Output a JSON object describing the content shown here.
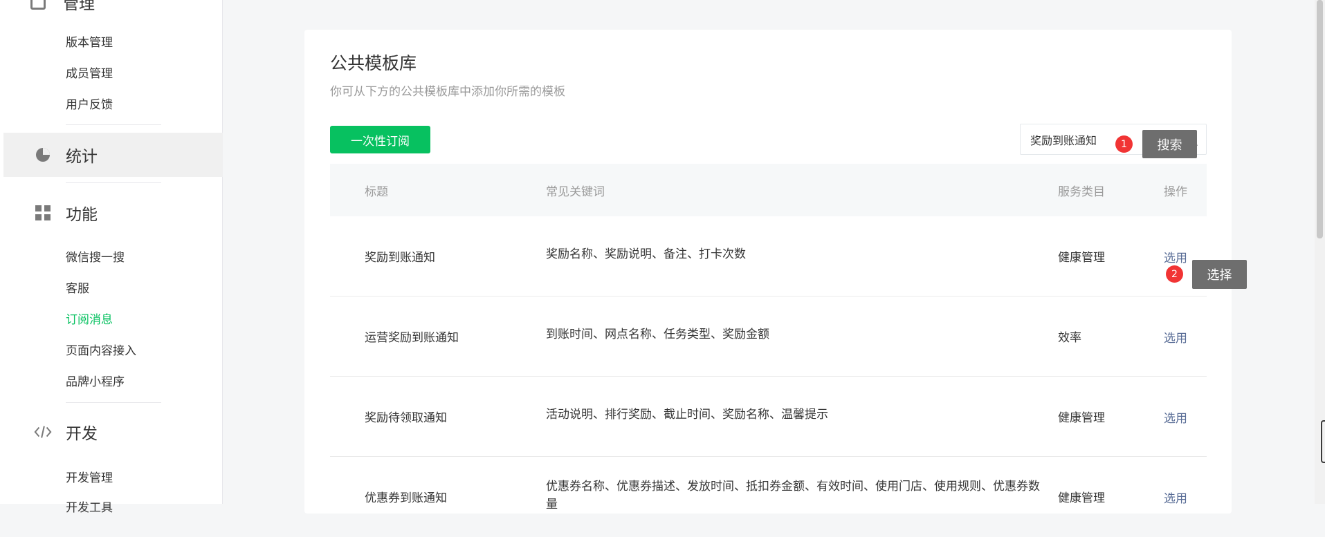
{
  "sidebar": {
    "partial_top_label": "管理",
    "manage_items": [
      "版本管理",
      "成员管理",
      "用户反馈"
    ],
    "stats_label": "统计",
    "features_label": "功能",
    "feature_items": [
      "微信搜一搜",
      "客服",
      "订阅消息",
      "页面内容接入",
      "品牌小程序"
    ],
    "develop_label": "开发",
    "develop_items": [
      "开发管理",
      "开发工具"
    ]
  },
  "main": {
    "title": "公共模板库",
    "description": "你可从下方的公共模板库中添加你所需的模板",
    "primary_button": "一次性订阅",
    "search": {
      "value": "奖励到账通知"
    },
    "table": {
      "headers": [
        "标题",
        "常见关键词",
        "服务类目",
        "操作"
      ],
      "rows": [
        {
          "title": "奖励到账通知",
          "keywords": "奖励名称、奖励说明、备注、打卡次数",
          "category": "健康管理",
          "action": "选用"
        },
        {
          "title": "运营奖励到账通知",
          "keywords": "到账时间、网点名称、任务类型、奖励金额",
          "category": "效率",
          "action": "选用"
        },
        {
          "title": "奖励待领取通知",
          "keywords": "活动说明、排行奖励、截止时间、奖励名称、温馨提示",
          "category": "健康管理",
          "action": "选用"
        },
        {
          "title": "优惠券到账通知",
          "keywords": "优惠券名称、优惠券描述、发放时间、抵扣券金额、有效时间、使用门店、使用规则、优惠券数量",
          "category": "健康管理",
          "action": "选用"
        }
      ]
    }
  },
  "annotations": [
    {
      "number": "1",
      "label": "搜索"
    },
    {
      "number": "2",
      "label": "选择"
    }
  ],
  "colors": {
    "accent_green": "#07c160",
    "link_blue": "#576b95",
    "badge_red": "#f13434"
  }
}
